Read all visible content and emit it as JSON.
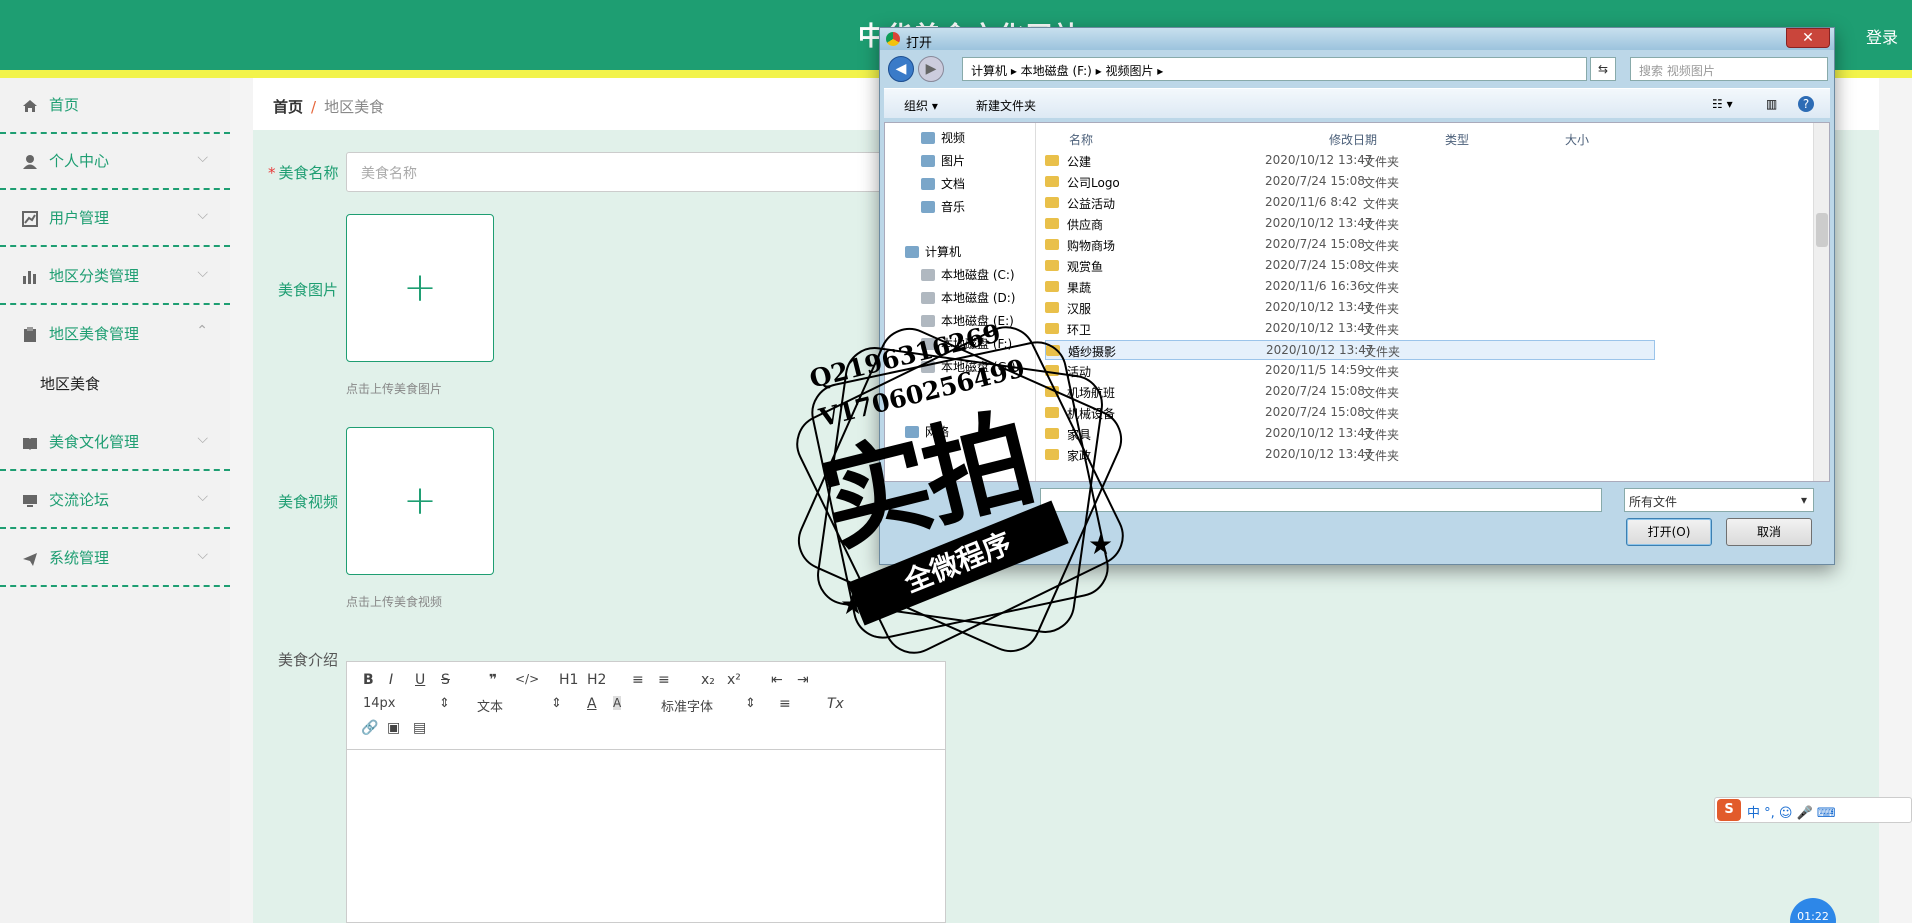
{
  "header": {
    "site_title": "中华美食文化网站",
    "right_text": "登录"
  },
  "sidebar": {
    "items": [
      {
        "label": "首页",
        "icon": "home-icon"
      },
      {
        "label": "个人中心",
        "icon": "user-icon"
      },
      {
        "label": "用户管理",
        "icon": "chart-icon"
      },
      {
        "label": "地区分类管理",
        "icon": "bar-chart-icon"
      },
      {
        "label": "地区美食管理",
        "icon": "clipboard-icon"
      },
      {
        "label": "美食文化管理",
        "icon": "book-icon"
      },
      {
        "label": "交流论坛",
        "icon": "monitor-icon"
      },
      {
        "label": "系统管理",
        "icon": "send-icon"
      }
    ],
    "submenu_label": "地区美食"
  },
  "breadcrumb": {
    "home": "首页",
    "separator": "/",
    "current": "地区美食"
  },
  "form": {
    "name_label": "美食名称",
    "name_placeholder": "美食名称",
    "image_label": "美食图片",
    "image_hint": "点击上传美食图片",
    "video_label": "美食视频",
    "video_hint": "点击上传美食视频",
    "intro_label": "美食介绍"
  },
  "editor": {
    "font_size": "14px",
    "text_style": "文本",
    "font_family": "标准字体",
    "buttons": [
      "B",
      "I",
      "U",
      "S",
      "❞",
      "</>",
      "H1",
      "H2",
      "≡",
      "≡",
      "x₂",
      "x²",
      "⇤",
      "⇥",
      "A",
      "A",
      "≡",
      "Tx"
    ]
  },
  "dialog": {
    "title": "打开",
    "address": "计算机 ▸ 本地磁盘 (F:) ▸ 视频图片 ▸",
    "search_placeholder": "搜索 视频图片",
    "toolbar": {
      "organize": "组织 ▾",
      "new_folder": "新建文件夹"
    },
    "tree": [
      {
        "label": "视频"
      },
      {
        "label": "图片"
      },
      {
        "label": "文档"
      },
      {
        "label": "音乐"
      },
      {
        "label": "计算机"
      },
      {
        "label": "本地磁盘 (C:)"
      },
      {
        "label": "本地磁盘 (D:)"
      },
      {
        "label": "本地磁盘 (E:)"
      },
      {
        "label": "本地磁盘 (F:)"
      },
      {
        "label": "本地磁盘 (G:)"
      },
      {
        "label": "网络"
      }
    ],
    "columns": {
      "name": "名称",
      "date": "修改日期",
      "type": "类型",
      "size": "大小"
    },
    "files": [
      {
        "name": "公建",
        "date": "2020/10/12 13:47",
        "type": "文件夹"
      },
      {
        "name": "公司Logo",
        "date": "2020/7/24 15:08",
        "type": "文件夹"
      },
      {
        "name": "公益活动",
        "date": "2020/11/6 8:42",
        "type": "文件夹"
      },
      {
        "name": "供应商",
        "date": "2020/10/12 13:47",
        "type": "文件夹"
      },
      {
        "name": "购物商场",
        "date": "2020/7/24 15:08",
        "type": "文件夹"
      },
      {
        "name": "观赏鱼",
        "date": "2020/7/24 15:08",
        "type": "文件夹"
      },
      {
        "name": "果蔬",
        "date": "2020/11/6 16:36",
        "type": "文件夹"
      },
      {
        "name": "汉服",
        "date": "2020/10/12 13:47",
        "type": "文件夹"
      },
      {
        "name": "环卫",
        "date": "2020/10/12 13:47",
        "type": "文件夹"
      },
      {
        "name": "婚纱摄影",
        "date": "2020/10/12 13:47",
        "type": "文件夹"
      },
      {
        "name": "活动",
        "date": "2020/11/5 14:59",
        "type": "文件夹"
      },
      {
        "name": "机场航班",
        "date": "2020/7/24 15:08",
        "type": "文件夹"
      },
      {
        "name": "机械设备",
        "date": "2020/7/24 15:08",
        "type": "文件夹"
      },
      {
        "name": "家具",
        "date": "2020/10/12 13:47",
        "type": "文件夹"
      },
      {
        "name": "家政",
        "date": "2020/10/12 13:47",
        "type": "文件夹"
      }
    ],
    "filter": "所有文件",
    "open_button": "打开(O)",
    "cancel_button": "取消",
    "close_glyph": "✕"
  },
  "watermark": {
    "line1": "Q2196316269",
    "line2": "V17060256499",
    "big": "实拍",
    "band": "全微程序"
  },
  "ime": {
    "text": "中 °, ☺ 🎤 ⌨"
  },
  "clock": {
    "text": "01:22"
  }
}
